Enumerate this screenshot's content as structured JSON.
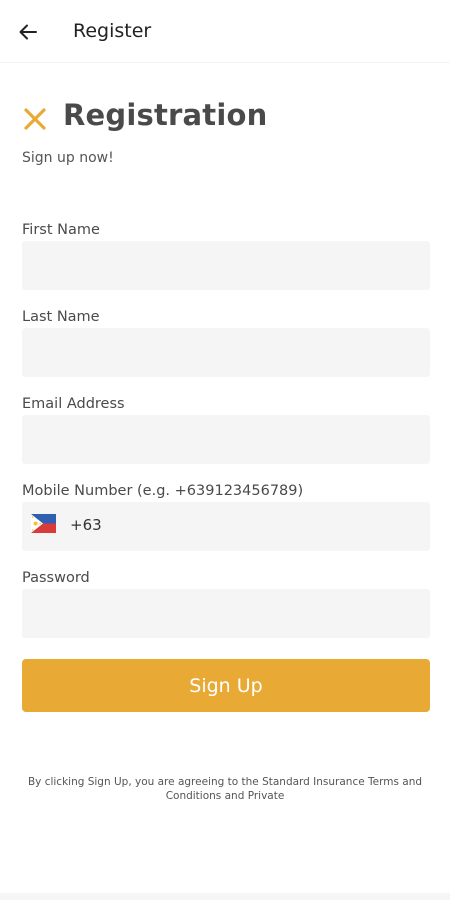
{
  "header": {
    "title": "Register",
    "back_icon": "arrow-left-icon"
  },
  "hero": {
    "icon": "crossed-tools-icon",
    "title": "Registration",
    "subtitle": "Sign up now!"
  },
  "form": {
    "first_name": {
      "label": "First Name",
      "value": "",
      "placeholder": ""
    },
    "last_name": {
      "label": "Last Name",
      "value": "",
      "placeholder": ""
    },
    "email": {
      "label": "Email Address",
      "value": "",
      "placeholder": ""
    },
    "mobile": {
      "label": "Mobile Number (e.g. +639123456789)",
      "country_flag": "philippines-flag-icon",
      "country_code": "+63",
      "value": ""
    },
    "password": {
      "label": "Password",
      "value": "",
      "placeholder": ""
    }
  },
  "actions": {
    "signup_label": "Sign Up"
  },
  "terms": {
    "text": "By clicking Sign Up, you are agreeing to the Standard Insurance Terms and Conditions and Private"
  },
  "colors": {
    "accent": "#e9aa35",
    "input_bg": "#f5f5f5",
    "heading": "#4a4a4a"
  }
}
